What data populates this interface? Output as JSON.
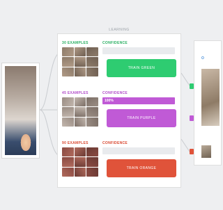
{
  "panel": {
    "title": "LEARNING"
  },
  "classes": [
    {
      "examples_label": "30 EXAMPLES",
      "confidence_label": "CONFIDENCE",
      "confidence_text": "",
      "confidence": 0.0,
      "button_label": "TRAIN GREEN",
      "color": "#2ecc71",
      "label_color": "#27ae60"
    },
    {
      "examples_label": "45 EXAMPLES",
      "confidence_label": "CONFIDENCE",
      "confidence_text": "100%",
      "confidence": 1.0,
      "button_label": "TRAIN PURPLE",
      "color": "#c05ad6",
      "label_color": "#b04ac8"
    },
    {
      "examples_label": "90 EXAMPLES",
      "confidence_label": "CONFIDENCE",
      "confidence_text": "",
      "confidence": 0.0,
      "button_label": "TRAIN ORANGE",
      "color": "#e0533a",
      "label_color": "#d9472f"
    }
  ],
  "output": {
    "label": "O"
  },
  "colors": {
    "green": "#2ecc71",
    "purple": "#c05ad6",
    "orange": "#e0533a"
  }
}
